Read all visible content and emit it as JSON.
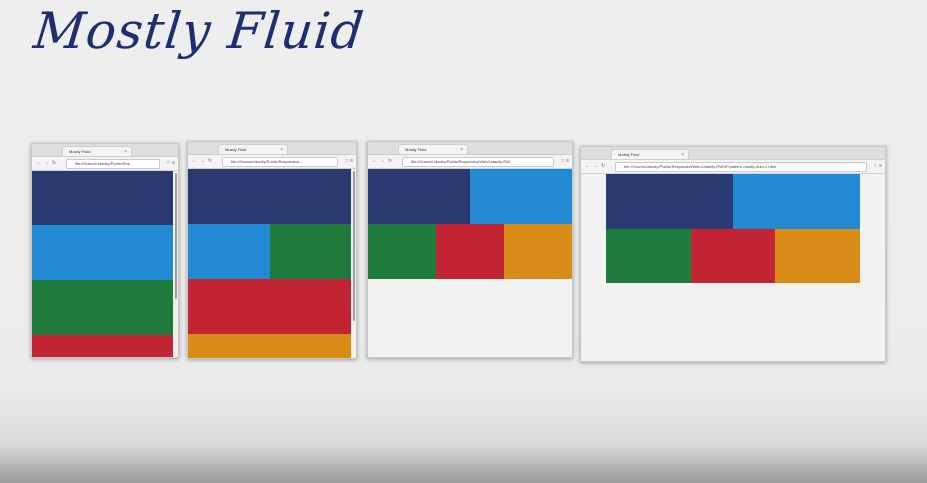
{
  "title": "Mostly Fluid",
  "colors": {
    "navy": "#283a6f",
    "blue": "#2289d3",
    "green": "#1e7a3d",
    "red": "#c42534",
    "orange": "#d98c17"
  },
  "windows": [
    {
      "tab_title": "Mostly Fluid",
      "url": "file:///Users/Udacity/Public/Res..."
    },
    {
      "tab_title": "Mostly Fluid",
      "url": "file:///Users/Udacity/Public/Responsive..."
    },
    {
      "tab_title": "Mostly Fluid",
      "url": "file:///Users/Udacity/Public/ResponsiveWeb/Udacity-RW..."
    },
    {
      "tab_title": "Mostly Fluid",
      "url": "file:///Users/Udacity/Public/ResponsiveWeb/Udacity-RWOF/pattern-mostly-fluid-2.html"
    }
  ]
}
